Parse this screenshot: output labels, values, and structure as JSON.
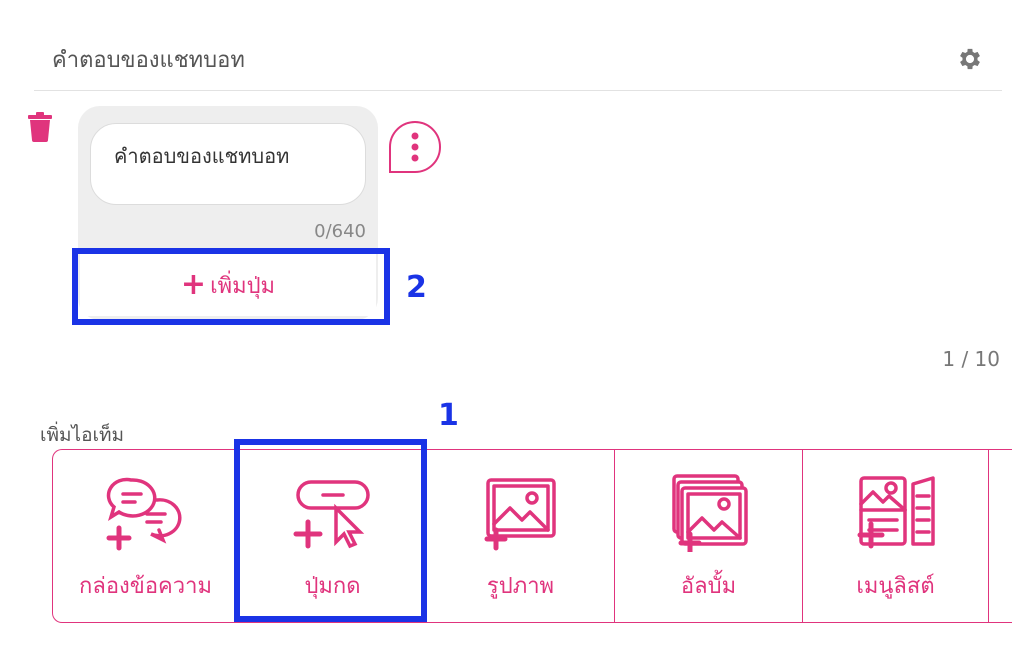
{
  "header": {
    "title": "คำตอบของแชทบอท"
  },
  "card": {
    "text_value": "คำตอบของแชทบอท",
    "counter": "0/640",
    "add_button_label": "เพิ่มปุ่ม",
    "add_button_plus": "+"
  },
  "annotations": {
    "box1_label": "1",
    "box2_label": "2"
  },
  "pager": "1 / 10",
  "add_items": {
    "label": "เพิ่มไอเท็ม",
    "items": [
      {
        "label": "กล่องข้อความ",
        "icon": "chat-bubbles-icon"
      },
      {
        "label": "ปุ่มกด",
        "icon": "button-cursor-icon"
      },
      {
        "label": "รูปภาพ",
        "icon": "image-icon"
      },
      {
        "label": "อัลบั้ม",
        "icon": "album-icon"
      },
      {
        "label": "เมนูลิสต์",
        "icon": "menu-list-icon"
      }
    ]
  },
  "colors": {
    "accent": "#e0347d",
    "highlight": "#1a33e6"
  }
}
